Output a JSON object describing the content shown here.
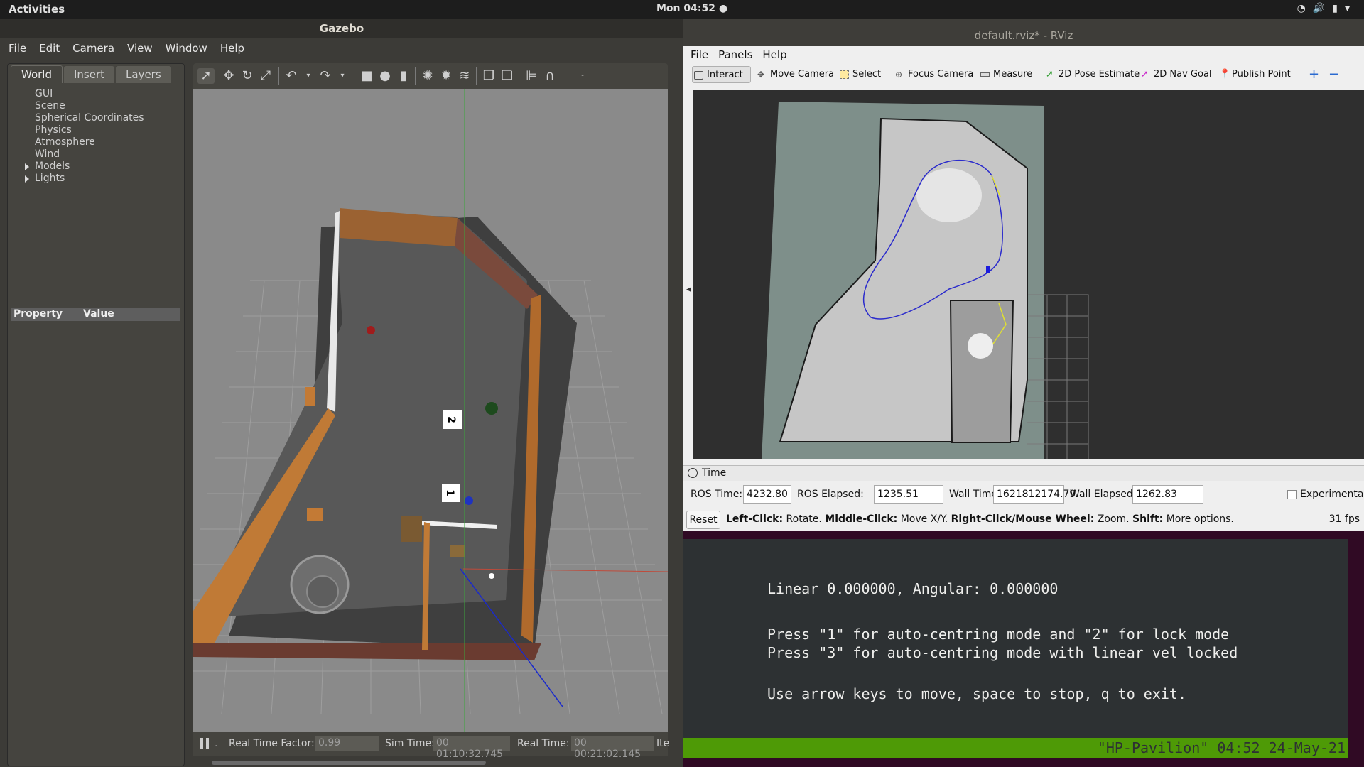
{
  "topbar": {
    "activities": "Activities",
    "clock": "Mon 04:52 ●"
  },
  "gazebo": {
    "title": "Gazebo",
    "menu": [
      "File",
      "Edit",
      "Camera",
      "View",
      "Window",
      "Help"
    ],
    "tabs": [
      "World",
      "Insert",
      "Layers"
    ],
    "tree": [
      "GUI",
      "Scene",
      "Spherical Coordinates",
      "Physics",
      "Atmosphere",
      "Wind",
      "Models",
      "Lights"
    ],
    "prop_header": {
      "property": "Property",
      "value": "Value"
    },
    "status": {
      "rtf_label": "Real Time Factor:",
      "rtf_value": "0.99",
      "sim_label": "Sim Time:",
      "sim_value": "00 01:10:32.745",
      "real_label": "Real Time:",
      "real_value": "00 00:21:02.145",
      "iter_label": "Ite"
    },
    "boxes": [
      "2",
      "1"
    ]
  },
  "rviz": {
    "title": "default.rviz* - RViz",
    "menu": [
      "File",
      "Panels",
      "Help"
    ],
    "tools": [
      "Interact",
      "Move Camera",
      "Select",
      "Focus Camera",
      "Measure",
      "2D Pose Estimate",
      "2D Nav Goal",
      "Publish Point"
    ],
    "time_panel_title": "Time",
    "ros_time_label": "ROS Time:",
    "ros_time": "4232.80",
    "ros_elapsed_label": "ROS Elapsed:",
    "ros_elapsed": "1235.51",
    "wall_time_label": "Wall Time:",
    "wall_time": "1621812174.79",
    "wall_elapsed_label": "Wall Elapsed:",
    "wall_elapsed": "1262.83",
    "experimental": "Experimental",
    "reset": "Reset",
    "help": {
      "lc": "Left-Click:",
      "lc_t": " Rotate. ",
      "mc": "Middle-Click:",
      "mc_t": " Move X/Y. ",
      "rc": "Right-Click/Mouse Wheel:",
      "rc_t": " Zoom. ",
      "sh": "Shift:",
      "sh_t": " More options."
    },
    "fps": "31 fps"
  },
  "terminal": {
    "line1": "Linear 0.000000, Angular: 0.000000",
    "line2": "Press \"1\" for auto-centring mode and \"2\" for lock mode",
    "line3": "Press \"3\" for auto-centring mode with linear vel locked",
    "line4": "Use arrow keys to move, space to stop, q to exit.",
    "status": "\"HP-Pavilion\" 04:52 24-May-21"
  }
}
